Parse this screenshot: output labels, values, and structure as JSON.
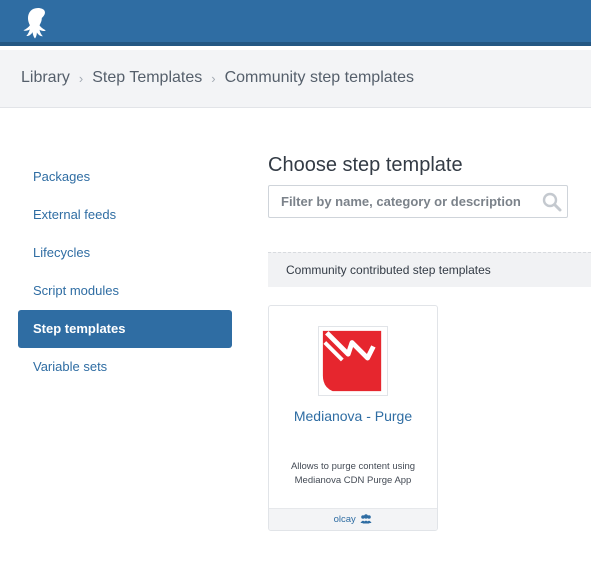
{
  "app": {
    "logo_icon": "octopus-logo-icon"
  },
  "breadcrumb": [
    {
      "label": "Library"
    },
    {
      "label": "Step Templates"
    },
    {
      "label": "Community step templates"
    }
  ],
  "sidebar": {
    "items": [
      {
        "label": "Packages",
        "active": false
      },
      {
        "label": "External feeds",
        "active": false
      },
      {
        "label": "Lifecycles",
        "active": false
      },
      {
        "label": "Script modules",
        "active": false
      },
      {
        "label": "Step templates",
        "active": true
      },
      {
        "label": "Variable sets",
        "active": false
      }
    ]
  },
  "main": {
    "title": "Choose step template",
    "search": {
      "placeholder": "Filter by name, category or description",
      "value": ""
    },
    "section_label": "Community contributed step templates",
    "templates": [
      {
        "name": "Medianova - Purge",
        "description": "Allows to purge content using Medianova CDN Purge App",
        "author": "olcay",
        "author_icon": "users-icon",
        "logo_icon": "medianova-logo-icon"
      }
    ]
  },
  "colors": {
    "brand": "#2f6da3",
    "medianova_red": "#e6262e"
  }
}
